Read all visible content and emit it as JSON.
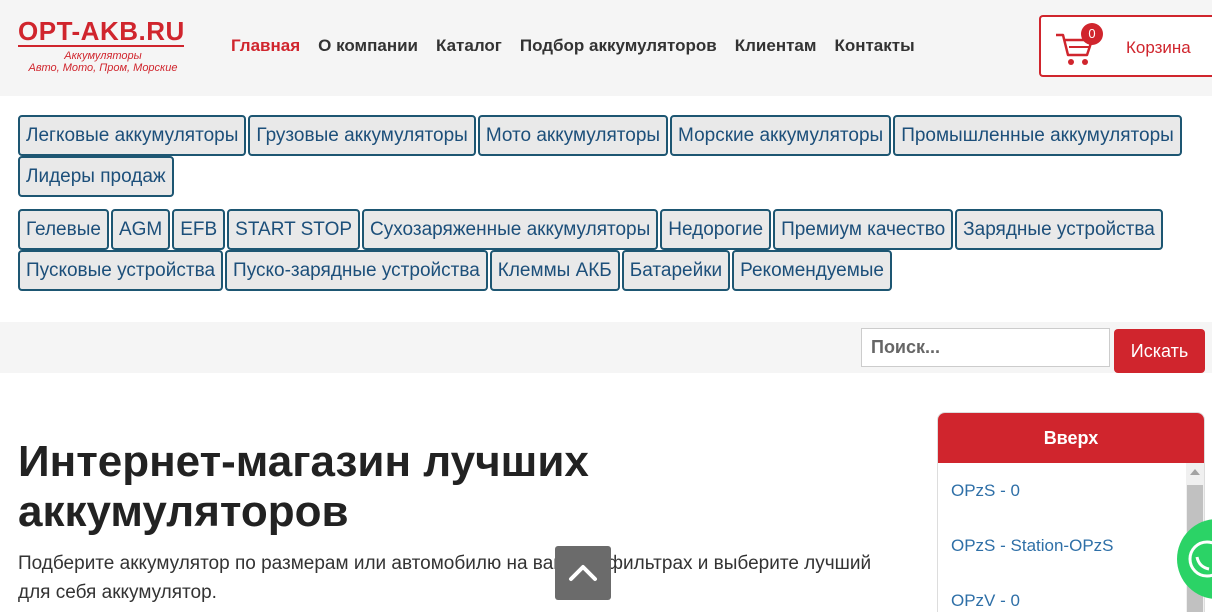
{
  "header": {
    "logo_title": "OPT-AKB.RU",
    "logo_sub1": "Аккумуляторы",
    "logo_sub2": "Авто, Мото, Пром, Морские",
    "nav": [
      {
        "label": "Главная"
      },
      {
        "label": "О компании"
      },
      {
        "label": "Каталог"
      },
      {
        "label": "Подбор аккумуляторов"
      },
      {
        "label": "Клиентам"
      },
      {
        "label": "Контакты"
      }
    ],
    "cart_count": "0",
    "cart_label": "Корзина"
  },
  "categories_row1": [
    "Легковые аккумуляторы",
    "Грузовые аккумуляторы",
    "Мото аккумуляторы",
    "Морские аккумуляторы",
    "Промышленные аккумуляторы",
    "Лидеры продаж"
  ],
  "categories_row2": [
    "Гелевые",
    "AGM",
    "EFB",
    "START STOP",
    "Сухозаряженные аккумуляторы",
    "Недорогие",
    "Премиум качество",
    "Зарядные устройства",
    "Пусковые устройства",
    "Пуско-зарядные устройства",
    "Клеммы АКБ",
    "Батарейки",
    "Рекомендуемые"
  ],
  "search": {
    "placeholder": "Поиск...",
    "button_label": "Искать"
  },
  "main": {
    "title": "Интернет-магазин лучших аккумуляторов",
    "description": "Подберите аккумулятор по размерам или автомобилю на вашных фильтрах и выберите лучший для себя аккумулятор."
  },
  "sidebar": {
    "header": "Вверх",
    "items": [
      "OPzS - 0",
      "OPzS - Station-OPzS",
      "OPzV - 0"
    ]
  },
  "colors": {
    "accent": "#d0252d",
    "link": "#2e6fa7",
    "category_border": "#1d5672"
  }
}
